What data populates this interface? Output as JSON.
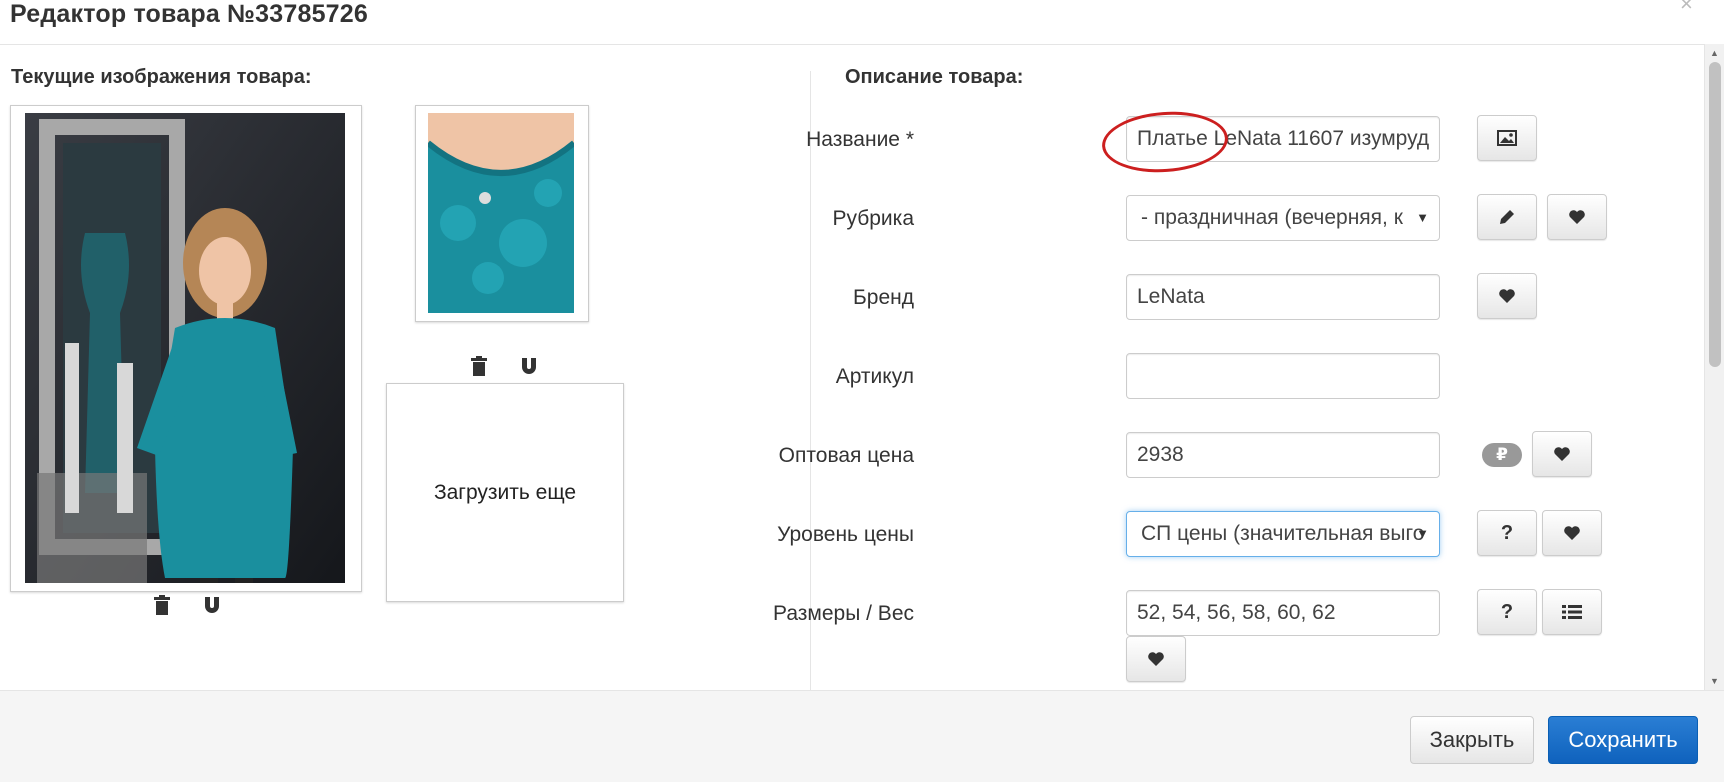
{
  "modal": {
    "title": "Редактор товара №33785726",
    "close_glyph": "×"
  },
  "images_section": {
    "title": "Текущие изображения товара:",
    "upload_label": "Загрузить еще"
  },
  "description_section": {
    "title": "Описание товара:",
    "fields": {
      "name": {
        "label": "Название *",
        "value": "Платье LeNata 11607 изумруд"
      },
      "category": {
        "label": "Рубрика",
        "value": "-  праздничная (вечерняя, к"
      },
      "brand": {
        "label": "Бренд",
        "value": "LeNata"
      },
      "sku": {
        "label": "Артикул",
        "value": ""
      },
      "wholesale_price": {
        "label": "Оптовая цена",
        "value": "2938",
        "currency": "₽"
      },
      "price_level": {
        "label": "Уровень цены",
        "value": "СП цены (значительная выго"
      },
      "sizes": {
        "label": "Размеры / Вес",
        "value": "52, 54, 56, 58, 60, 62"
      }
    },
    "help_glyph": "?"
  },
  "footer": {
    "close_label": "Закрыть",
    "save_label": "Сохранить"
  },
  "colors": {
    "primary": "#1565c0",
    "dress_teal": "#1a8f9e",
    "annotation_red": "#cc1f1f"
  },
  "icons": [
    "close-icon",
    "trash-icon",
    "magnet-icon",
    "image-icon",
    "pencil-icon",
    "heart-icon",
    "ruble-icon",
    "list-icon",
    "caret-down-icon"
  ]
}
